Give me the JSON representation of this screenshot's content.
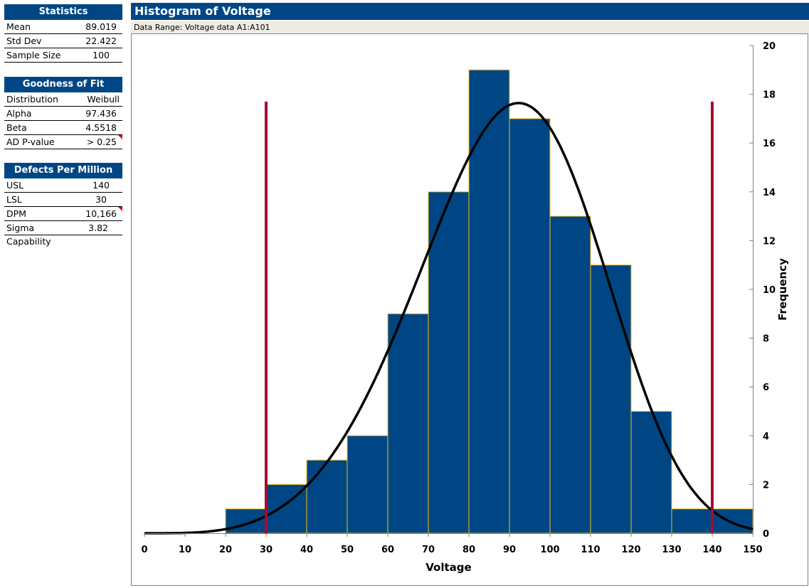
{
  "statistics": {
    "header": "Statistics",
    "rows": [
      {
        "label": "Mean",
        "value": "89.019"
      },
      {
        "label": "Std Dev",
        "value": "22.422"
      },
      {
        "label": "Sample Size",
        "value": "100"
      }
    ]
  },
  "goodness_of_fit": {
    "header": "Goodness of Fit",
    "rows": [
      {
        "label": "Distribution",
        "value": "Weibull"
      },
      {
        "label": "Alpha",
        "value": "97.436"
      },
      {
        "label": "Beta",
        "value": "4.5518"
      },
      {
        "label": "AD P-value",
        "value": "> 0.25",
        "flag": true
      }
    ]
  },
  "defects_per_million": {
    "header": "Defects Per Million",
    "rows": [
      {
        "label": "USL",
        "value": "140"
      },
      {
        "label": "LSL",
        "value": "30"
      },
      {
        "label": "DPM",
        "value": "10,166",
        "flag": true
      },
      {
        "label": "Sigma Capability",
        "value": "3.82"
      }
    ]
  },
  "chart_header": {
    "title": "Histogram of Voltage",
    "data_range": "Data Range: Voltage data A1:A101"
  },
  "colors": {
    "bar_fill": "#004684",
    "bar_edge": "#f0c020",
    "spec_line": "#a50c30",
    "curve": "#000000",
    "header_bg": "#004684",
    "subheader_bg": "#eeece1"
  },
  "chart_data": {
    "type": "bar",
    "title": "Histogram of Voltage",
    "xlabel": "Voltage",
    "ylabel": "Frequency",
    "xlim": [
      0,
      150
    ],
    "ylim": [
      0,
      20
    ],
    "x_ticks": [
      0,
      10,
      20,
      30,
      40,
      50,
      60,
      70,
      80,
      90,
      100,
      110,
      120,
      130,
      140,
      150
    ],
    "y_ticks": [
      0,
      2,
      4,
      6,
      8,
      10,
      12,
      14,
      16,
      18,
      20
    ],
    "y_axis_side": "right",
    "grid": false,
    "bin_edges": [
      20,
      30,
      40,
      50,
      60,
      70,
      80,
      90,
      100,
      110,
      120,
      130,
      140,
      150
    ],
    "categories": [
      "20-30",
      "30-40",
      "40-50",
      "50-60",
      "60-70",
      "70-80",
      "80-90",
      "90-100",
      "100-110",
      "110-120",
      "120-130",
      "130-140",
      "140-150"
    ],
    "values": [
      1,
      2,
      3,
      4,
      9,
      14,
      19,
      17,
      13,
      11,
      5,
      1,
      1
    ],
    "fitted_curve": {
      "distribution": "Weibull",
      "alpha": 97.436,
      "beta": 4.5518,
      "sample_size": 100,
      "bin_width": 10
    },
    "spec_limits": [
      {
        "name": "LSL",
        "value": 30
      },
      {
        "name": "USL",
        "value": 140
      }
    ]
  }
}
